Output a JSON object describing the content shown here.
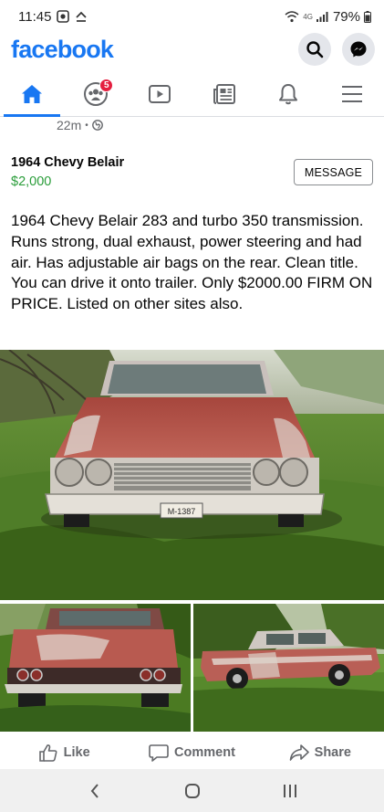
{
  "status_bar": {
    "time": "11:45",
    "network": "4G",
    "battery": "79%"
  },
  "header": {
    "logo": "facebook",
    "icons": [
      "search-icon",
      "messenger-icon"
    ]
  },
  "nav": {
    "tabs": [
      {
        "name": "home",
        "icon": "home-icon",
        "active": true
      },
      {
        "name": "groups",
        "icon": "groups-icon",
        "badge": "5"
      },
      {
        "name": "watch",
        "icon": "video-icon"
      },
      {
        "name": "marketplace",
        "icon": "news-icon"
      },
      {
        "name": "notifications",
        "icon": "bell-icon"
      },
      {
        "name": "menu",
        "icon": "hamburger-icon"
      }
    ]
  },
  "post": {
    "timestamp": "22m",
    "separator": "•",
    "privacy_icon": "globe-icon"
  },
  "listing": {
    "title": "1964 Chevy Belair",
    "price": "$2,000",
    "message_label": "MESSAGE",
    "description": "1964 Chevy Belair 283 and turbo 350 transmission. Runs strong, dual exhaust, power steering and had air.  Has adjustable air bags on the rear. Clean title. You can drive it onto trailer. Only $2000.00 FIRM ON PRICE.  Listed on other sites also.",
    "license_plate": "M-1387"
  },
  "actions": {
    "like": "Like",
    "comment": "Comment",
    "share": "Share"
  },
  "colors": {
    "brand": "#1877f2",
    "price": "#2a9d3a",
    "badge": "#e41e3f",
    "car_paint": "#b5524a"
  }
}
